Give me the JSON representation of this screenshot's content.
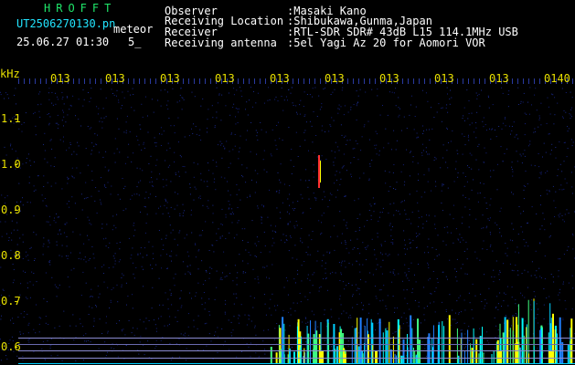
{
  "header": {
    "app_title": "HROFFT",
    "filename": "UT2506270130.pn",
    "mode": "meteor",
    "datetime": "25.06.27 01:30",
    "count": "5_",
    "fields": [
      {
        "label": "Observer",
        "value": ":Masaki Kano"
      },
      {
        "label": "Receiving Location",
        "value": ":Shibukawa,Gunma,Japan"
      },
      {
        "label": "Receiver",
        "value": ":RTL-SDR SDR# 43dB L15 114.1MHz USB"
      },
      {
        "label": "Receiving antenna",
        "value": ":5el Yagi Az 20 for Aomori VOR"
      }
    ]
  },
  "axis": {
    "unit": "kHz",
    "y_ticks": [
      "1.1",
      "1.0",
      "0.9",
      "0.8",
      "0.7",
      "0.6"
    ],
    "x_ticks": [
      "013",
      "013",
      "013",
      "013",
      "013",
      "013",
      "013",
      "013",
      "013",
      "0140"
    ]
  },
  "colors": {
    "background": "#000000",
    "label_white": "#ffffff",
    "label_cyan": "#22e5ff",
    "title_green": "#1fe66a",
    "axis_yellow": "#e8e000",
    "noise_blue": "#1a2a8a",
    "echo_cyan": "#00ffff",
    "echo_yellow": "#ffff00",
    "echo_red": "#ff3030"
  }
}
